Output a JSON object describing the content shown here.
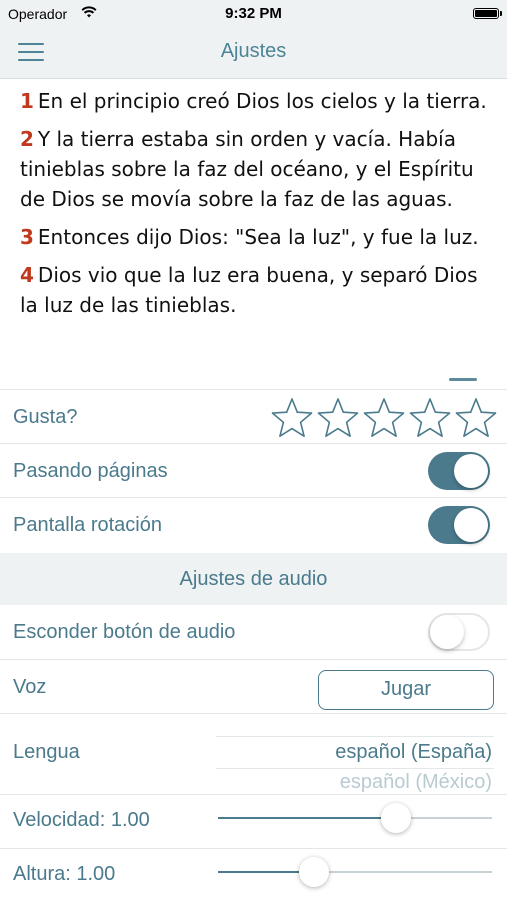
{
  "status_bar": {
    "carrier": "Operador",
    "time": "9:32 PM"
  },
  "nav": {
    "title": "Ajustes",
    "menu_icon": "hamburger-menu-icon"
  },
  "verses": [
    {
      "num": "1",
      "text": "En el principio creó Dios los cielos y la tierra."
    },
    {
      "num": "2",
      "text": "Y la tierra estaba sin orden y vacía. Había tinieblas sobre la faz del océano, y el Espíritu de Dios se movía sobre la faz de las aguas."
    },
    {
      "num": "3",
      "text": "Entonces dijo Dios: \"Sea la luz\", y fue la luz."
    },
    {
      "num": "4",
      "text": "Dios vio que la luz era buena, y separó Dios la luz de las tinieblas."
    }
  ],
  "settings": {
    "rating_label": "Gusta?",
    "rating_stars_total": 5,
    "rating_value": 0,
    "page_turn_label": "Pasando páginas",
    "page_turn_on": true,
    "rotation_label": "Pantalla rotación",
    "rotation_on": true
  },
  "audio": {
    "section_title": "Ajustes de audio",
    "hide_button_label": "Esconder botón de audio",
    "hide_button_on": false,
    "voice_label": "Voz",
    "play_button": "Jugar",
    "language_label": "Lengua",
    "language_selected": "español (España)",
    "language_next": "español (México)",
    "speed_label": "Velocidad: 1.00",
    "speed_fraction": 0.65,
    "pitch_label": "Altura: 1.00",
    "pitch_fraction": 0.35
  },
  "colors": {
    "accent": "#4a7a8c",
    "verse_number": "#c0391e",
    "bar_bg": "#eef2f3"
  }
}
